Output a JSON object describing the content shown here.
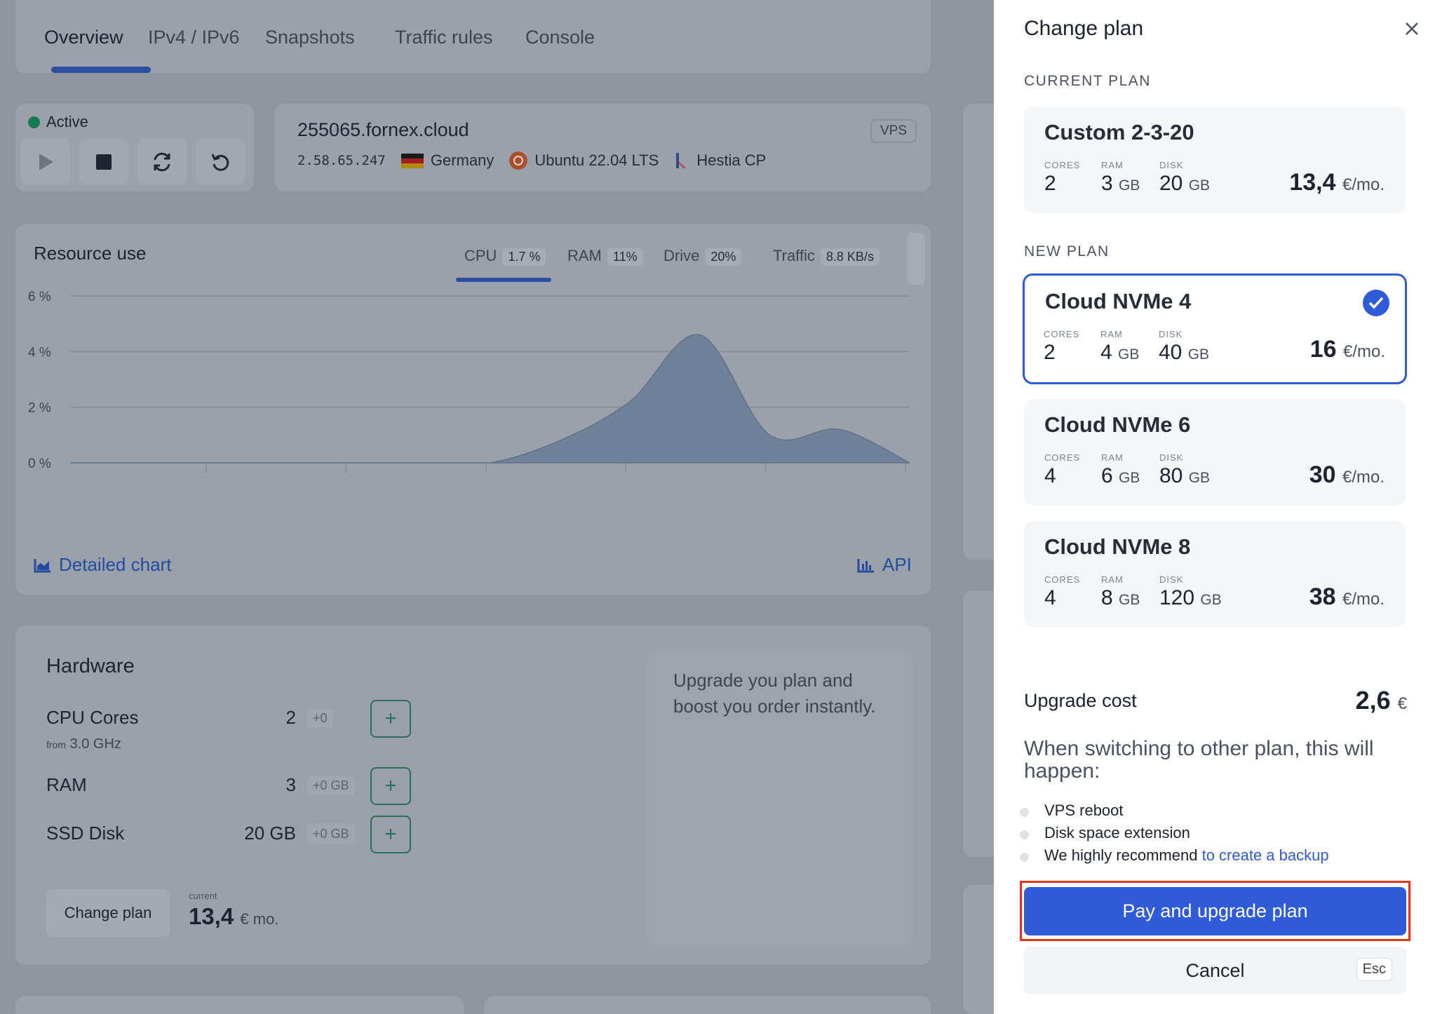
{
  "background": {
    "tabs": [
      "Overview",
      "IPv4 / IPv6",
      "Snapshots",
      "Traffic rules",
      "Console"
    ],
    "status": "Active",
    "server": {
      "hostname": "255065.fornex.cloud",
      "type_badge": "VPS",
      "ip": "2.58.65.247",
      "country": "Germany",
      "os": "Ubuntu 22.04 LTS",
      "panel": "Hestia CP"
    },
    "resource": {
      "title": "Resource use",
      "metrics": [
        {
          "label": "CPU",
          "value": "1.7 %"
        },
        {
          "label": "RAM",
          "value": "11%"
        },
        {
          "label": "Drive",
          "value": "20%"
        },
        {
          "label": "Traffic",
          "value": "8.8 KB/s"
        }
      ],
      "detailed_link": "Detailed chart",
      "api_link": "API"
    },
    "chart_data": {
      "type": "area",
      "ylabels": [
        "6 %",
        "4 %",
        "2 %",
        "0 %"
      ],
      "ylim": [
        0,
        6
      ],
      "x": [
        0,
        1,
        2,
        3,
        4,
        5,
        6,
        7,
        8,
        9,
        10,
        11,
        12
      ],
      "values": [
        0,
        0,
        0,
        0,
        0,
        0,
        0,
        0.8,
        2.2,
        4.6,
        1.0,
        1.2,
        0
      ],
      "grid": true
    },
    "hardware": {
      "title": "Hardware",
      "rows": [
        {
          "label": "CPU Cores",
          "value": "2",
          "delta": "+0"
        },
        {
          "label": "RAM",
          "value": "3",
          "delta": "+0 GB"
        },
        {
          "label": "SSD Disk",
          "value": "20 GB",
          "delta": "+0 GB"
        }
      ],
      "cpu_from": "from",
      "cpu_freq": "3.0 GHz",
      "note": "Upgrade you plan and boost you order instantly.",
      "change_button": "Change plan",
      "current_label": "current",
      "current_price": "13,4",
      "current_unit": "€ mo."
    }
  },
  "panel": {
    "title": "Change plan",
    "current_section": "CURRENT PLAN",
    "new_section": "NEW PLAN",
    "spec_labels": {
      "cores": "CORES",
      "ram": "RAM",
      "disk": "DISK"
    },
    "price_unit": "€/mo.",
    "current_plan": {
      "name": "Custom 2-3-20",
      "cores": "2",
      "ram": "3",
      "disk": "20",
      "price": "13,4"
    },
    "new_plans": [
      {
        "name": "Cloud NVMe 4",
        "cores": "2",
        "ram": "4",
        "disk": "40",
        "price": "16",
        "selected": true
      },
      {
        "name": "Cloud NVMe 6",
        "cores": "4",
        "ram": "6",
        "disk": "80",
        "price": "30",
        "selected": false
      },
      {
        "name": "Cloud NVMe 8",
        "cores": "4",
        "ram": "8",
        "disk": "120",
        "price": "38",
        "selected": false
      }
    ],
    "gb_unit": "GB",
    "upgrade_label": "Upgrade cost",
    "upgrade_cost": "2,6",
    "upgrade_currency": "€",
    "switch_heading": "When switching to other plan, this will happen:",
    "bullets": [
      "VPS reboot",
      "Disk space extension"
    ],
    "recommend_text": "We highly recommend ",
    "recommend_link": "to create a backup",
    "pay_button": "Pay and upgrade plan",
    "cancel_button": "Cancel",
    "esc_key": "Esc",
    "accent": "#2f5bd8",
    "highlight": "#e0351b"
  }
}
